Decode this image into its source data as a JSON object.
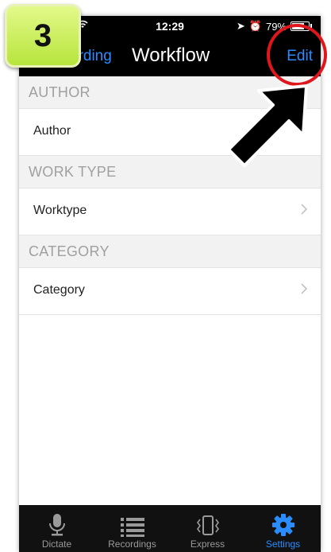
{
  "status": {
    "time": "12:29",
    "battery": "79%"
  },
  "nav": {
    "back_label": "arding",
    "title": "Workflow",
    "edit_label": "Edit"
  },
  "sections": [
    {
      "header": "AUTHOR",
      "row_label": "Author"
    },
    {
      "header": "WORK TYPE",
      "row_label": "Worktype"
    },
    {
      "header": "CATEGORY",
      "row_label": "Category"
    }
  ],
  "tabs": [
    {
      "label": "Dictate",
      "icon": "microphone-icon"
    },
    {
      "label": "Recordings",
      "icon": "list-icon"
    },
    {
      "label": "Express",
      "icon": "phone-vibrate-icon"
    },
    {
      "label": "Settings",
      "icon": "gear-icon"
    }
  ],
  "annotation": {
    "step_number": "3"
  },
  "colors": {
    "accent": "#2a8cff",
    "highlight": "#e0161d",
    "badge": "#c6ee5a"
  }
}
